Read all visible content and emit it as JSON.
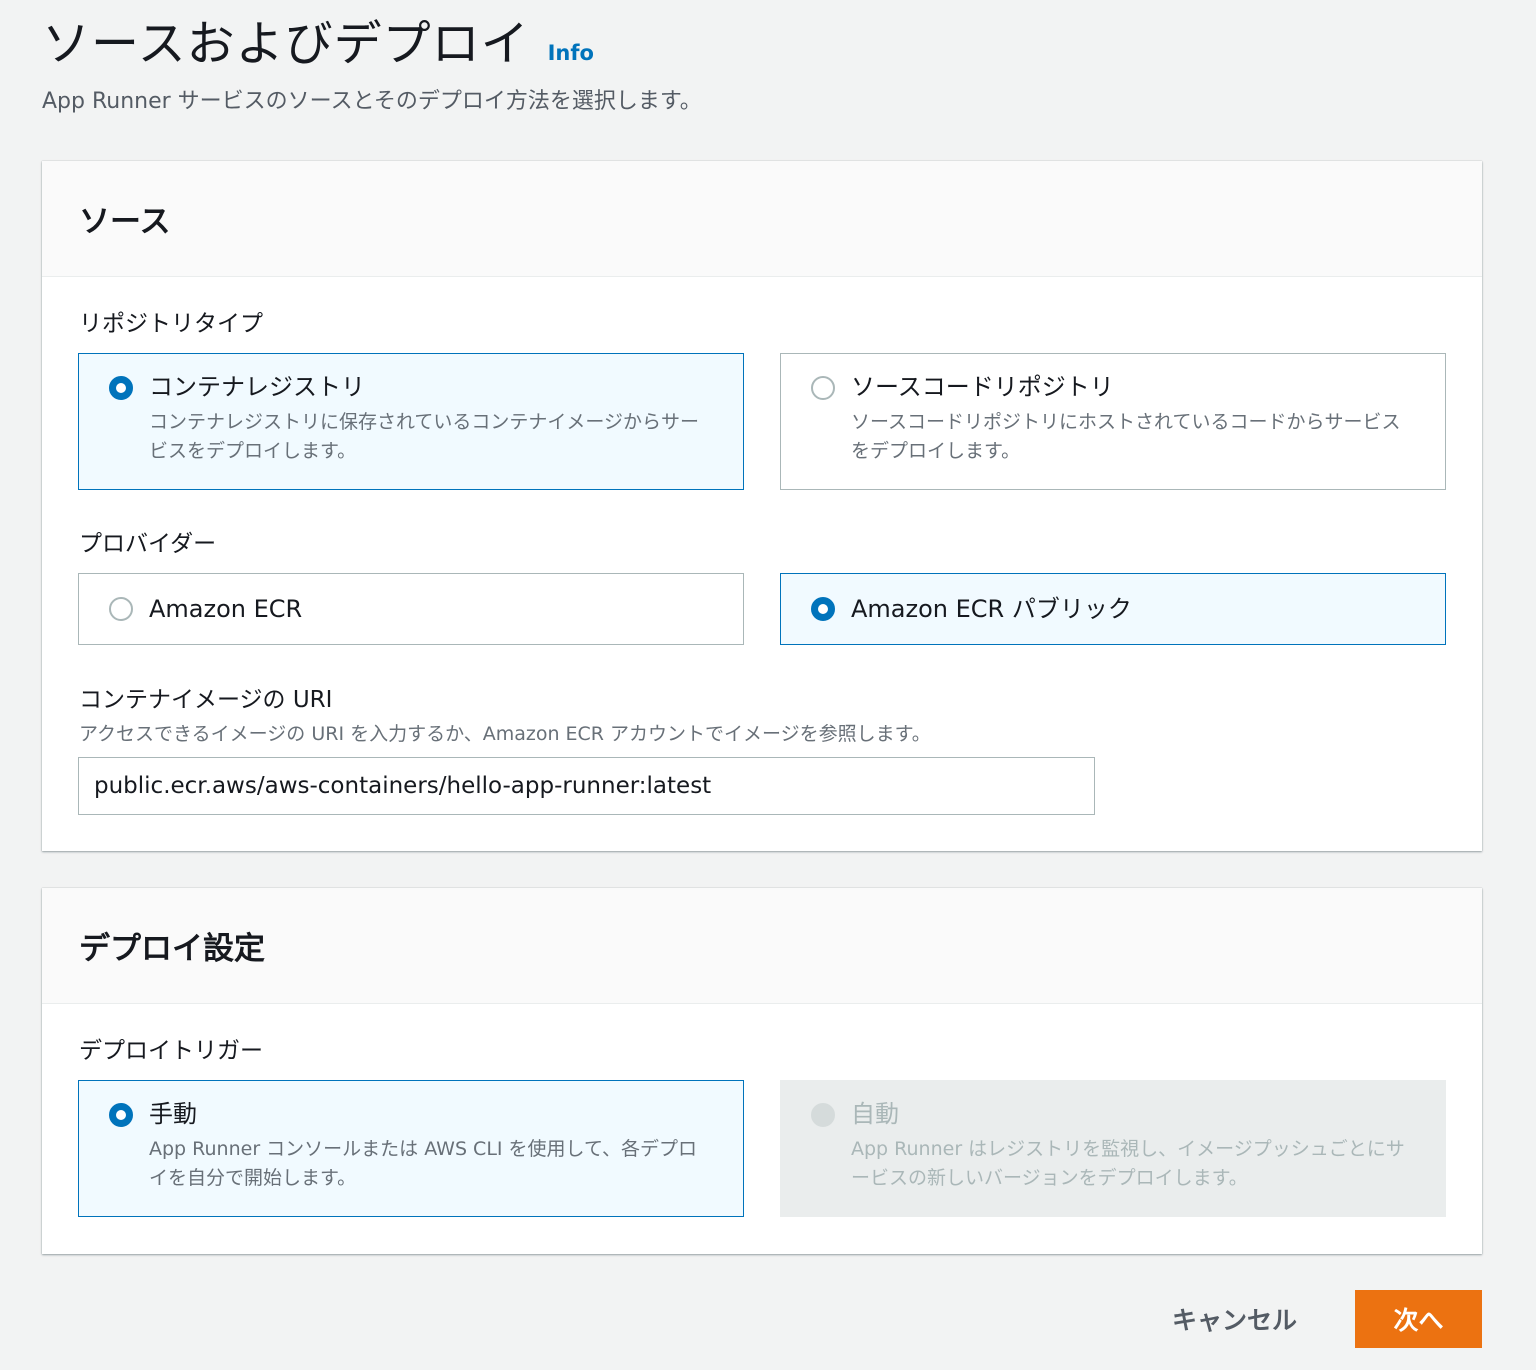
{
  "header": {
    "title": "ソースおよびデプロイ",
    "info_label": "Info",
    "description": "App Runner サービスのソースとそのデプロイ方法を選択します。"
  },
  "source": {
    "heading": "ソース",
    "repository_type": {
      "label": "リポジトリタイプ",
      "selected": "container_registry",
      "options": [
        {
          "id": "container_registry",
          "title": "コンテナレジストリ",
          "description": "コンテナレジストリに保存されているコンテナイメージからサービスをデプロイします。"
        },
        {
          "id": "source_code_repository",
          "title": "ソースコードリポジトリ",
          "description": "ソースコードリポジトリにホストされているコードからサービスをデプロイします。"
        }
      ]
    },
    "provider": {
      "label": "プロバイダー",
      "selected": "ecr_public",
      "options": [
        {
          "id": "ecr",
          "title": "Amazon ECR"
        },
        {
          "id": "ecr_public",
          "title": "Amazon ECR パブリック"
        }
      ]
    },
    "image_uri": {
      "label": "コンテナイメージの URI",
      "hint": "アクセスできるイメージの URI を入力するか、Amazon ECR アカウントでイメージを参照します。",
      "value": "public.ecr.aws/aws-containers/hello-app-runner:latest"
    }
  },
  "deployment": {
    "heading": "デプロイ設定",
    "trigger": {
      "label": "デプロイトリガー",
      "selected": "manual",
      "options": [
        {
          "id": "manual",
          "title": "手動",
          "description": "App Runner コンソールまたは AWS CLI を使用して、各デプロイを自分で開始します。"
        },
        {
          "id": "automatic",
          "title": "自動",
          "description": "App Runner はレジストリを監視し、イメージプッシュごとにサービスの新しいバージョンをデプロイします。",
          "disabled": true
        }
      ]
    }
  },
  "actions": {
    "cancel_label": "キャンセル",
    "next_label": "次へ"
  },
  "colors": {
    "accent": "#0073bb",
    "primary_button": "#ec7211",
    "selected_tile_bg": "#f1faff",
    "background": "#f2f3f3"
  }
}
